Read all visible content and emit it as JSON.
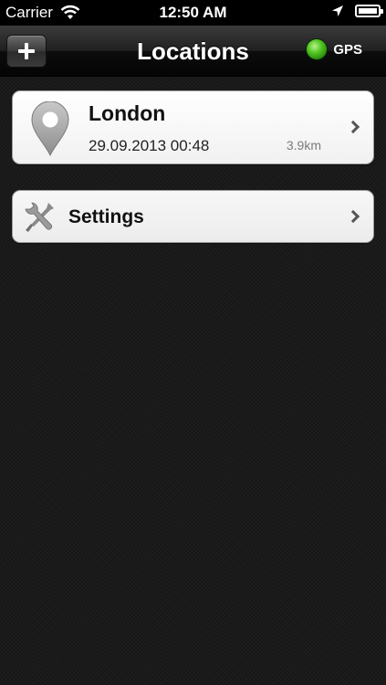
{
  "status_bar": {
    "carrier": "Carrier",
    "time": "12:50 AM",
    "icons": [
      "wifi-icon",
      "location-arrow-icon",
      "battery-icon"
    ]
  },
  "nav_bar": {
    "title": "Locations",
    "add_button_icon": "plus-icon",
    "gps_label": "GPS",
    "gps_indicator_color": "#4fc320"
  },
  "locations": [
    {
      "name": "London",
      "date": "29.09.2013 00:48",
      "distance": "3.9km",
      "icon": "map-pin-icon"
    }
  ],
  "settings": {
    "label": "Settings",
    "icon": "wrench-screwdriver-icon"
  }
}
